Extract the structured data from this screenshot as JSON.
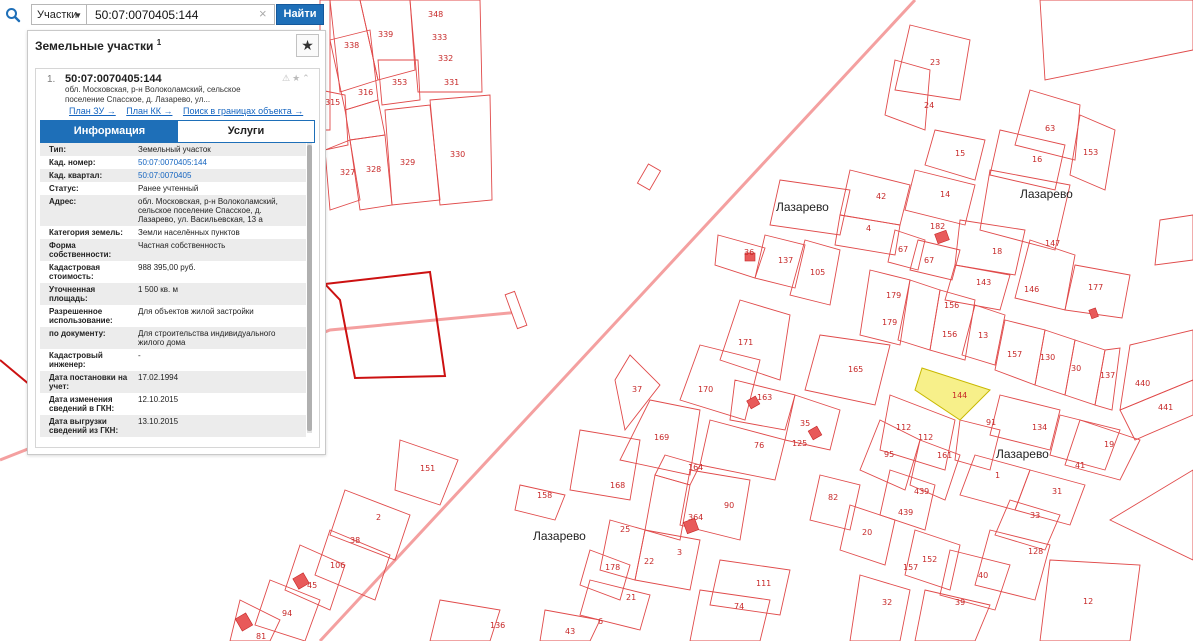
{
  "search": {
    "type_select": "Участки",
    "query": "50:07:0070405:144",
    "find_label": "Найти"
  },
  "panel": {
    "title": "Земельные участки",
    "title_sup": "1",
    "result": {
      "index": "1.",
      "cad_number": "50:07:0070405:144",
      "address_short": "обл. Московская, р-н Волоколамский, сельское поселение Спасское, д. Лазарево, ул...",
      "links": [
        "План ЗУ →",
        "План КК →",
        "Поиск в границах объекта →"
      ]
    },
    "tabs": [
      "Информация",
      "Услуги"
    ],
    "rows": [
      {
        "k": "Тип:",
        "v": "Земельный участок"
      },
      {
        "k": "Кад. номер:",
        "v": "50:07:0070405:144",
        "link": true
      },
      {
        "k": "Кад. квартал:",
        "v": "50:07:0070405",
        "link": true
      },
      {
        "k": "Статус:",
        "v": "Ранее учтенный"
      },
      {
        "k": "Адрес:",
        "v": "обл. Московская, р-н Волоколамский, сельское поселение Спасское, д. Лазарево, ул. Васильевская, 13 а"
      },
      {
        "k": "Категория земель:",
        "v": "Земли населённых пунктов"
      },
      {
        "k": "Форма собственности:",
        "v": "Частная собственность"
      },
      {
        "k": "Кадастровая стоимость:",
        "v": "988 395,00 руб."
      },
      {
        "k": "Уточненная площадь:",
        "v": "1 500 кв. м"
      },
      {
        "k": "Разрешенное использование:",
        "v": "Для объектов жилой застройки"
      },
      {
        "k": "по документу:",
        "v": "Для строительства индивидуального жилого дома"
      },
      {
        "k": "Кадастровый инженер:",
        "v": "-"
      },
      {
        "k": "Дата постановки на учет:",
        "v": "17.02.1994"
      },
      {
        "k": "Дата изменения сведений в ГКН:",
        "v": "12.10.2015"
      },
      {
        "k": "Дата выгрузки сведений из ГКН:",
        "v": "13.10.2015"
      }
    ]
  },
  "map": {
    "places": [
      "Лазарево",
      "Лазарево",
      "Лазарево",
      "Лазарево"
    ],
    "highlight_color": "#f7f08a",
    "plot_labels": [
      "348",
      "339",
      "338",
      "333",
      "332",
      "331",
      "353",
      "316",
      "315",
      "327",
      "328",
      "329",
      "330",
      "23",
      "24",
      "15",
      "63",
      "16",
      "153",
      "42",
      "14",
      "182",
      "4",
      "67",
      "67",
      "36",
      "137",
      "105",
      "18",
      "143",
      "147",
      "146",
      "177",
      "179",
      "179",
      "156",
      "156",
      "13",
      "157",
      "130",
      "30",
      "137",
      "440",
      "441",
      "171",
      "165",
      "37",
      "170",
      "163",
      "35",
      "125",
      "76",
      "169",
      "144",
      "91",
      "134",
      "112",
      "112",
      "95",
      "161",
      "19",
      "41",
      "1",
      "31",
      "33",
      "168",
      "164",
      "90",
      "82",
      "20",
      "439",
      "439",
      "158",
      "364",
      "3",
      "151",
      "2",
      "38",
      "106",
      "25",
      "22",
      "178",
      "128",
      "40",
      "152",
      "157",
      "111",
      "21",
      "74",
      "39",
      "32",
      "12",
      "136",
      "43",
      "6",
      "45",
      "94",
      "81"
    ]
  }
}
